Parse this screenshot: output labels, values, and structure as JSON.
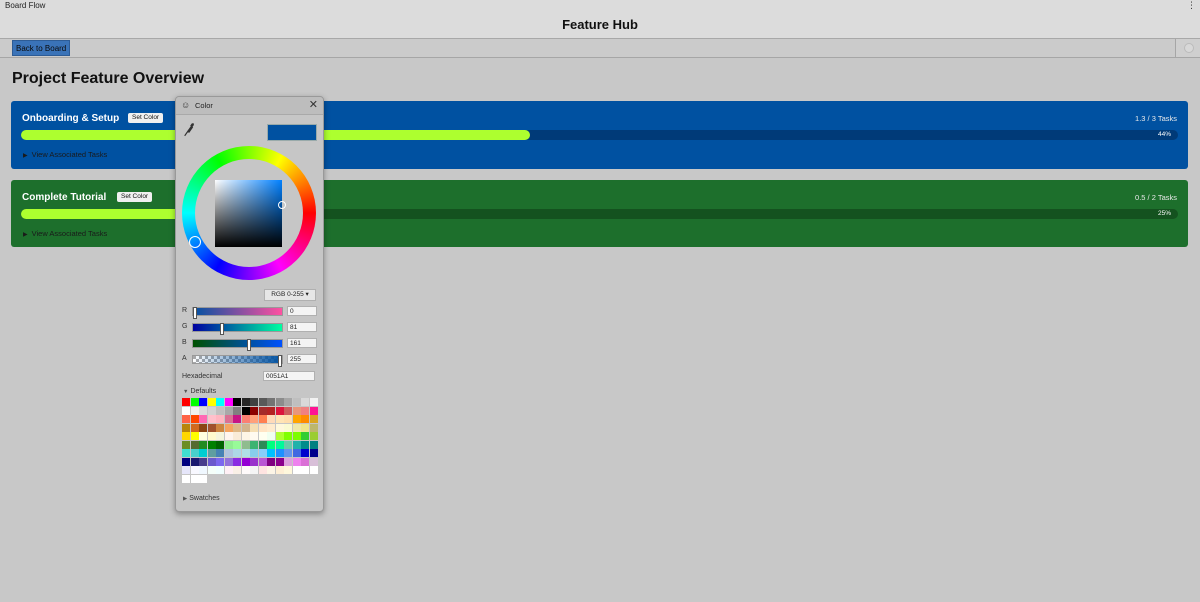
{
  "window": {
    "tab_label": "Board Flow",
    "menu_glyph": "⋮"
  },
  "app": {
    "title": "Feature Hub"
  },
  "toolbar": {
    "back_label": "Back to Board"
  },
  "page": {
    "title": "Project Feature Overview"
  },
  "features": [
    {
      "title": "Onboarding & Setup",
      "set_color_label": "Set Color",
      "tasks": "1.3 / 3 Tasks",
      "progress": 0.44,
      "progress_label": "44%",
      "associated_label": "View Associated Tasks",
      "color": "#0051a1"
    },
    {
      "title": "Complete Tutorial",
      "set_color_label": "Set Color",
      "tasks": "0.5 / 2 Tasks",
      "progress": 0.25,
      "progress_label": "25%",
      "associated_label": "View Associated Tasks",
      "color": "#1d6f2c"
    }
  ],
  "picker": {
    "title": "Color",
    "close_glyph": "✕",
    "eyedropper_icon": "eyedropper-icon",
    "current_color": "#0051A1",
    "mode": "RGB 0-255",
    "channels": [
      {
        "label": "R",
        "value": "0",
        "fraction": 0.0
      },
      {
        "label": "G",
        "value": "81",
        "fraction": 0.318
      },
      {
        "label": "B",
        "value": "161",
        "fraction": 0.631
      },
      {
        "label": "A",
        "value": "255",
        "fraction": 1.0
      }
    ],
    "hex_label": "Hexadecimal",
    "hex_value": "0051A1",
    "defaults_label": "Defaults",
    "swatches_label": "Swatches",
    "palette": [
      "#ff0000",
      "#00ff00",
      "#0000ff",
      "#ffff00",
      "#00ffff",
      "#ff00ff",
      "#000000",
      "#262626",
      "#404040",
      "#595959",
      "#737373",
      "#8c8c8c",
      "#a6a6a6",
      "#bfbfbf",
      "#d9d9d9",
      "#f2f2f2",
      "#ffffff",
      "#f0f0f0",
      "#dcdcdc",
      "#d3d3d3",
      "#c0c0c0",
      "#a9a9a9",
      "#808080",
      "#000000",
      "#8b0000",
      "#a52a2a",
      "#b22222",
      "#dc143c",
      "#cd5c5c",
      "#e9967a",
      "#f08080",
      "#ff1493",
      "#ff6347",
      "#ff4500",
      "#ff69b4",
      "#ffc0cb",
      "#ffb6c1",
      "#db7093",
      "#c71585",
      "#fa8072",
      "#ffa07a",
      "#ff7f50",
      "#ffdab9",
      "#ffe4b5",
      "#ffdead",
      "#ffa500",
      "#ff8c00",
      "#daa520",
      "#b8860b",
      "#d2691e",
      "#8b4513",
      "#a0522d",
      "#cd853f",
      "#f4a460",
      "#deb887",
      "#d2b48c",
      "#f5deb3",
      "#ffe4c4",
      "#ffebcd",
      "#fff8dc",
      "#fafad2",
      "#eee8aa",
      "#f0e68c",
      "#bdb76b",
      "#ffd700",
      "#ffff00",
      "#ffffe0",
      "#fffacd",
      "#f5f5dc",
      "#fff5ee",
      "#faebd7",
      "#fdf5e6",
      "#fffaf0",
      "#fffff0",
      "#f0fff0",
      "#adff2f",
      "#7fff00",
      "#7cfc00",
      "#32cd32",
      "#9acd32",
      "#6b8e23",
      "#556b2f",
      "#228b22",
      "#008000",
      "#006400",
      "#90ee90",
      "#98fb98",
      "#8fbc8f",
      "#3cb371",
      "#2e8b57",
      "#00ff7f",
      "#00fa9a",
      "#66cdaa",
      "#20b2aa",
      "#008b8b",
      "#008080",
      "#40e0d0",
      "#48d1cc",
      "#00ced1",
      "#5f9ea0",
      "#4682b4",
      "#b0c4de",
      "#add8e6",
      "#b0e0e6",
      "#87ceeb",
      "#87cefa",
      "#00bfff",
      "#1e90ff",
      "#6495ed",
      "#4169e1",
      "#0000cd",
      "#00008b",
      "#000080",
      "#191970",
      "#483d8b",
      "#6a5acd",
      "#7b68ee",
      "#9370db",
      "#8a2be2",
      "#9400d3",
      "#9932cc",
      "#ba55d3",
      "#800080",
      "#8b008b",
      "#dda0dd",
      "#ee82ee",
      "#da70d6",
      "#d8bfd8",
      "#e6e6fa",
      "#f8f8ff",
      "#f0f8ff",
      "#f5fffa",
      "#f0ffff",
      "#fff0f5",
      "#faf0e6",
      "#fffafa",
      "#f5f5f5",
      "#ffe4e1",
      "#fdf5e6",
      "#ffefd5",
      "#fff8dc",
      "#ffffff",
      "#ffffff",
      "#ffffff",
      "#ffffff",
      "#ffffff",
      "#ffffff"
    ]
  }
}
